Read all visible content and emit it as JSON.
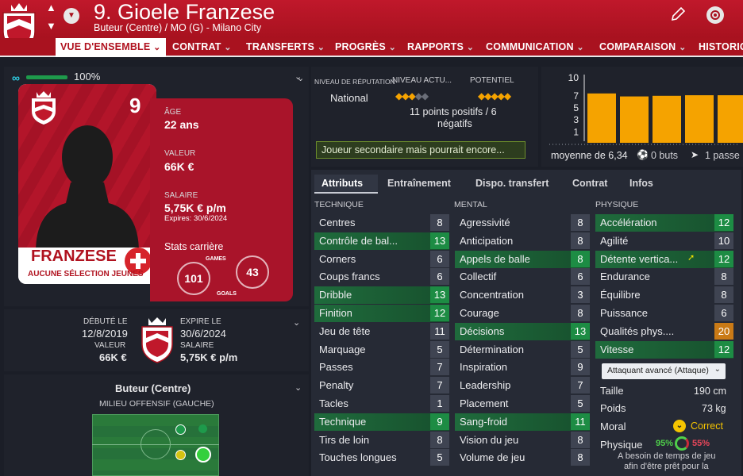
{
  "header": {
    "title": "9. Gioele Franzese",
    "subtitle": "Buteur (Centre) / MO (G) - Milano City"
  },
  "nav": [
    "VUE D'ENSEMBLE",
    "CONTRAT",
    "TRANSFERTS",
    "PROGRÈS",
    "RAPPORTS",
    "COMMUNICATION",
    "COMPARAISON",
    "HISTORIQ"
  ],
  "card": {
    "condition": "100%",
    "number": "9",
    "surname": "FRANZESE",
    "selection": "AUCUNE SÉLECTION JEUNES",
    "age_label": "ÂGE",
    "age": "22 ans",
    "value_label": "VALEUR",
    "value": "66K €",
    "salary_label": "SALAIRE",
    "salary": "5,75K € p/m",
    "expires": "Expires: 30/6/2024",
    "career_label": "Stats carrière",
    "games_label": "GAMES",
    "games": "101",
    "goals_label": "GOALS",
    "goals": "43"
  },
  "contract": {
    "debut_label": "DÉBUTÉ LE",
    "debut": "12/8/2019",
    "value_label": "VALEUR",
    "value": "66K €",
    "expire_label": "EXPIRE LE",
    "expire": "30/6/2024",
    "salary_label": "SALAIRE",
    "salary": "5,75K € p/m"
  },
  "positions": {
    "main": "Buteur (Centre)",
    "second": "MILIEU OFFENSIF (GAUCHE)"
  },
  "reputation": {
    "label": "NIVEAU DE RÉPUTATION",
    "current_label": "NIVEAU ACTU...",
    "potential_label": "POTENTIEL",
    "level": "National",
    "current_stars": 2.5,
    "potential_stars": 4.5,
    "points": "11 points positifs / 6",
    "negatives": "négatifs",
    "role": "Joueur secondaire mais pourrait encore..."
  },
  "form": {
    "y_ticks": [
      "10",
      "7",
      "5",
      "3",
      "1"
    ],
    "values": [
      7.4,
      6.9,
      7.0,
      7.1,
      7.1
    ],
    "avg": "moyenne de 6,34",
    "goals": "0 buts",
    "assists": "1 passe"
  },
  "tabs": [
    "Attributs",
    "Entraînement",
    "Dispo. transfert",
    "Contrat",
    "Infos"
  ],
  "attributes": {
    "technique_label": "TECHNIQUE",
    "mental_label": "MENTAL",
    "physique_label": "PHYSIQUE",
    "technique": [
      {
        "name": "Centres",
        "value": "8",
        "hl": false
      },
      {
        "name": "Contrôle de bal...",
        "value": "13",
        "hl": true
      },
      {
        "name": "Corners",
        "value": "6",
        "hl": false
      },
      {
        "name": "Coups francs",
        "value": "6",
        "hl": false
      },
      {
        "name": "Dribble",
        "value": "13",
        "hl": true
      },
      {
        "name": "Finition",
        "value": "12",
        "hl": true
      },
      {
        "name": "Jeu de tête",
        "value": "11",
        "hl": false
      },
      {
        "name": "Marquage",
        "value": "5",
        "hl": false
      },
      {
        "name": "Passes",
        "value": "7",
        "hl": false
      },
      {
        "name": "Penalty",
        "value": "7",
        "hl": false
      },
      {
        "name": "Tacles",
        "value": "1",
        "hl": false
      },
      {
        "name": "Technique",
        "value": "9",
        "hl": true
      },
      {
        "name": "Tirs de loin",
        "value": "8",
        "hl": false
      },
      {
        "name": "Touches longues",
        "value": "5",
        "hl": false
      }
    ],
    "mental": [
      {
        "name": "Agressivité",
        "value": "8",
        "hl": false
      },
      {
        "name": "Anticipation",
        "value": "8",
        "hl": false
      },
      {
        "name": "Appels de balle",
        "value": "8",
        "hl": true
      },
      {
        "name": "Collectif",
        "value": "6",
        "hl": false
      },
      {
        "name": "Concentration",
        "value": "3",
        "hl": false
      },
      {
        "name": "Courage",
        "value": "8",
        "hl": false
      },
      {
        "name": "Décisions",
        "value": "13",
        "hl": true
      },
      {
        "name": "Détermination",
        "value": "5",
        "hl": false
      },
      {
        "name": "Inspiration",
        "value": "9",
        "hl": false
      },
      {
        "name": "Leadership",
        "value": "7",
        "hl": false
      },
      {
        "name": "Placement",
        "value": "5",
        "hl": false
      },
      {
        "name": "Sang-froid",
        "value": "11",
        "hl": true
      },
      {
        "name": "Vision du jeu",
        "value": "8",
        "hl": false
      },
      {
        "name": "Volume de jeu",
        "value": "8",
        "hl": false
      }
    ],
    "physique": [
      {
        "name": "Accélération",
        "value": "12",
        "hl": true
      },
      {
        "name": "Agilité",
        "value": "10",
        "hl": false
      },
      {
        "name": "Détente vertica...",
        "value": "12",
        "hl": true
      },
      {
        "name": "Endurance",
        "value": "8",
        "hl": false
      },
      {
        "name": "Équilibre",
        "value": "8",
        "hl": false
      },
      {
        "name": "Puissance",
        "value": "6",
        "hl": false
      },
      {
        "name": "Qualités phys....",
        "value": "20",
        "hl": false
      },
      {
        "name": "Vitesse",
        "value": "12",
        "hl": true
      }
    ]
  },
  "info": {
    "role_select": "Attaquant avancé (Attaque)",
    "height_label": "Taille",
    "height": "190 cm",
    "weight_label": "Poids",
    "weight": "73 kg",
    "morale_label": "Moral",
    "morale": "Correct",
    "physique_label": "Physique",
    "phys_a": "95%",
    "phys_b": "55%",
    "note1": "A besoin de temps de jeu",
    "note2": "afin d'être prêt pour la"
  },
  "colors": {
    "accent": "#b0121f",
    "highlight": "#1d8c44",
    "orange": "#c97a16",
    "bars": "#f5a300"
  }
}
